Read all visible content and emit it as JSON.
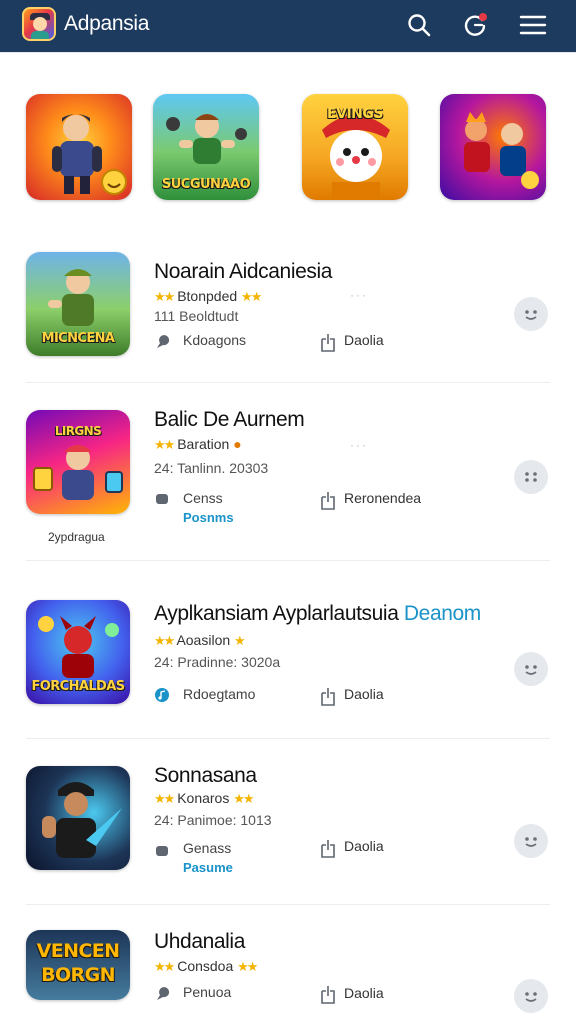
{
  "header": {
    "title": "Adpansia",
    "icons": [
      "search-icon",
      "refresh-icon",
      "menu-icon"
    ],
    "colors": {
      "bar": "#1d3a5f",
      "badge": "#e63946"
    }
  },
  "featured": [
    {
      "icon": "hero-character-art"
    },
    {
      "icon": "adventure-game-art",
      "caption": "SUCGUNAAO"
    },
    {
      "icon": "snowman-mascot-art",
      "caption": "EVINGS"
    },
    {
      "icon": "battle-game-art"
    }
  ],
  "apps": [
    {
      "name": "Noarain Aidcaniesia",
      "rating_text": "Btonpded",
      "meta": "111  Beoldtudt",
      "sub_label": "Kdoagons",
      "download_label": "Daolia",
      "icon_caption": "MICNCENA"
    },
    {
      "name": "Balic De Aurnem",
      "rating_text": "Baration",
      "meta": "24:  Tanlinn. 20303",
      "sub_label": "Censs",
      "sub_link": "Posnms",
      "download_label": "Reronendea",
      "icon_caption_top": "LIRGNS",
      "under_caption": "2ypdragua"
    },
    {
      "name_main": "Ayplkansiam Ayplarlautsuia",
      "name_accent": "Deanom",
      "rating_text": "Aoasilon",
      "meta": "24:  Pradinne: 3020a",
      "sub_label": "Rdoegtamo",
      "download_label": "Daolia",
      "icon_caption": "FORCHALDAS"
    },
    {
      "name": "Sonnasana",
      "rating_text": "Konaros",
      "meta": "24:  Panimoe: 1013",
      "sub_label": "Genass",
      "sub_link": "Pasume",
      "download_label": "Daolia"
    },
    {
      "name": "Uhdanalia",
      "rating_text": "Consdoa",
      "sub_label": "Penuoa",
      "download_label": "Daolia",
      "icon_caption_1": "VENCEN",
      "icon_caption_2": "BORGN"
    }
  ],
  "colors": {
    "accent": "#1a93c9",
    "star": "#f4b400"
  }
}
